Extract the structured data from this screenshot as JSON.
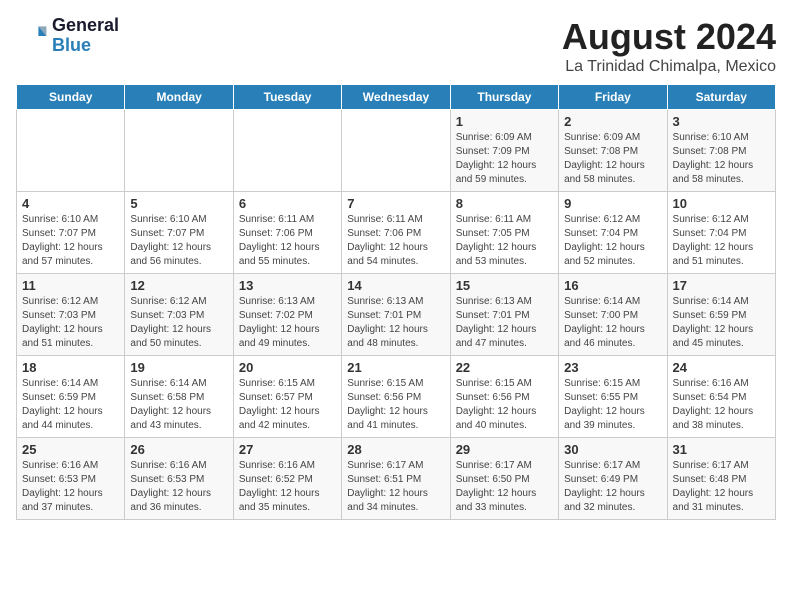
{
  "logo": {
    "line1": "General",
    "line2": "Blue"
  },
  "title": "August 2024",
  "subtitle": "La Trinidad Chimalpa, Mexico",
  "days_of_week": [
    "Sunday",
    "Monday",
    "Tuesday",
    "Wednesday",
    "Thursday",
    "Friday",
    "Saturday"
  ],
  "weeks": [
    [
      {
        "day": "",
        "info": ""
      },
      {
        "day": "",
        "info": ""
      },
      {
        "day": "",
        "info": ""
      },
      {
        "day": "",
        "info": ""
      },
      {
        "day": "1",
        "info": "Sunrise: 6:09 AM\nSunset: 7:09 PM\nDaylight: 12 hours\nand 59 minutes."
      },
      {
        "day": "2",
        "info": "Sunrise: 6:09 AM\nSunset: 7:08 PM\nDaylight: 12 hours\nand 58 minutes."
      },
      {
        "day": "3",
        "info": "Sunrise: 6:10 AM\nSunset: 7:08 PM\nDaylight: 12 hours\nand 58 minutes."
      }
    ],
    [
      {
        "day": "4",
        "info": "Sunrise: 6:10 AM\nSunset: 7:07 PM\nDaylight: 12 hours\nand 57 minutes."
      },
      {
        "day": "5",
        "info": "Sunrise: 6:10 AM\nSunset: 7:07 PM\nDaylight: 12 hours\nand 56 minutes."
      },
      {
        "day": "6",
        "info": "Sunrise: 6:11 AM\nSunset: 7:06 PM\nDaylight: 12 hours\nand 55 minutes."
      },
      {
        "day": "7",
        "info": "Sunrise: 6:11 AM\nSunset: 7:06 PM\nDaylight: 12 hours\nand 54 minutes."
      },
      {
        "day": "8",
        "info": "Sunrise: 6:11 AM\nSunset: 7:05 PM\nDaylight: 12 hours\nand 53 minutes."
      },
      {
        "day": "9",
        "info": "Sunrise: 6:12 AM\nSunset: 7:04 PM\nDaylight: 12 hours\nand 52 minutes."
      },
      {
        "day": "10",
        "info": "Sunrise: 6:12 AM\nSunset: 7:04 PM\nDaylight: 12 hours\nand 51 minutes."
      }
    ],
    [
      {
        "day": "11",
        "info": "Sunrise: 6:12 AM\nSunset: 7:03 PM\nDaylight: 12 hours\nand 51 minutes."
      },
      {
        "day": "12",
        "info": "Sunrise: 6:12 AM\nSunset: 7:03 PM\nDaylight: 12 hours\nand 50 minutes."
      },
      {
        "day": "13",
        "info": "Sunrise: 6:13 AM\nSunset: 7:02 PM\nDaylight: 12 hours\nand 49 minutes."
      },
      {
        "day": "14",
        "info": "Sunrise: 6:13 AM\nSunset: 7:01 PM\nDaylight: 12 hours\nand 48 minutes."
      },
      {
        "day": "15",
        "info": "Sunrise: 6:13 AM\nSunset: 7:01 PM\nDaylight: 12 hours\nand 47 minutes."
      },
      {
        "day": "16",
        "info": "Sunrise: 6:14 AM\nSunset: 7:00 PM\nDaylight: 12 hours\nand 46 minutes."
      },
      {
        "day": "17",
        "info": "Sunrise: 6:14 AM\nSunset: 6:59 PM\nDaylight: 12 hours\nand 45 minutes."
      }
    ],
    [
      {
        "day": "18",
        "info": "Sunrise: 6:14 AM\nSunset: 6:59 PM\nDaylight: 12 hours\nand 44 minutes."
      },
      {
        "day": "19",
        "info": "Sunrise: 6:14 AM\nSunset: 6:58 PM\nDaylight: 12 hours\nand 43 minutes."
      },
      {
        "day": "20",
        "info": "Sunrise: 6:15 AM\nSunset: 6:57 PM\nDaylight: 12 hours\nand 42 minutes."
      },
      {
        "day": "21",
        "info": "Sunrise: 6:15 AM\nSunset: 6:56 PM\nDaylight: 12 hours\nand 41 minutes."
      },
      {
        "day": "22",
        "info": "Sunrise: 6:15 AM\nSunset: 6:56 PM\nDaylight: 12 hours\nand 40 minutes."
      },
      {
        "day": "23",
        "info": "Sunrise: 6:15 AM\nSunset: 6:55 PM\nDaylight: 12 hours\nand 39 minutes."
      },
      {
        "day": "24",
        "info": "Sunrise: 6:16 AM\nSunset: 6:54 PM\nDaylight: 12 hours\nand 38 minutes."
      }
    ],
    [
      {
        "day": "25",
        "info": "Sunrise: 6:16 AM\nSunset: 6:53 PM\nDaylight: 12 hours\nand 37 minutes."
      },
      {
        "day": "26",
        "info": "Sunrise: 6:16 AM\nSunset: 6:53 PM\nDaylight: 12 hours\nand 36 minutes."
      },
      {
        "day": "27",
        "info": "Sunrise: 6:16 AM\nSunset: 6:52 PM\nDaylight: 12 hours\nand 35 minutes."
      },
      {
        "day": "28",
        "info": "Sunrise: 6:17 AM\nSunset: 6:51 PM\nDaylight: 12 hours\nand 34 minutes."
      },
      {
        "day": "29",
        "info": "Sunrise: 6:17 AM\nSunset: 6:50 PM\nDaylight: 12 hours\nand 33 minutes."
      },
      {
        "day": "30",
        "info": "Sunrise: 6:17 AM\nSunset: 6:49 PM\nDaylight: 12 hours\nand 32 minutes."
      },
      {
        "day": "31",
        "info": "Sunrise: 6:17 AM\nSunset: 6:48 PM\nDaylight: 12 hours\nand 31 minutes."
      }
    ]
  ]
}
